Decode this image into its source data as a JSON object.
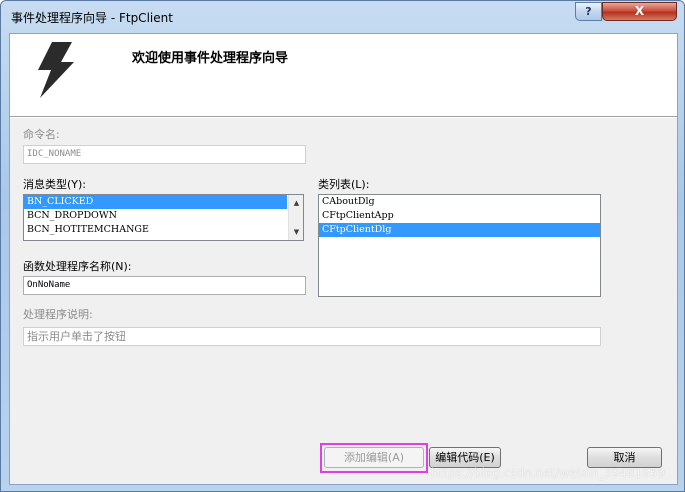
{
  "window": {
    "title": "事件处理程序向导 - FtpClient",
    "help_label": "?",
    "close_label": "X"
  },
  "banner": {
    "icon": "lightning-bolt-icon",
    "title": "欢迎使用事件处理程序向导"
  },
  "command_name": {
    "label": "命令名:",
    "value": "IDC_NONAME"
  },
  "message_type": {
    "label": "消息类型(Y):",
    "items": [
      "BN_CLICKED",
      "BCN_DROPDOWN",
      "BCN_HOTITEMCHANGE"
    ],
    "selected": "BN_CLICKED"
  },
  "class_list": {
    "label": "类列表(L):",
    "items": [
      "CAboutDlg",
      "CFtpClientApp",
      "CFtpClientDlg"
    ],
    "selected": "CFtpClientDlg"
  },
  "handler_name": {
    "label": "函数处理程序名称(N):",
    "value": "OnNoName"
  },
  "handler_desc": {
    "label": "处理程序说明:",
    "value": "指示用户单击了按钮"
  },
  "buttons": {
    "add_edit": "添加编辑(A)",
    "edit_code": "编辑代码(E)",
    "cancel": "取消"
  },
  "watermark": "https://blog.csdn.net/weixin_39481659",
  "colors": {
    "selection": "#3399ff",
    "highlight_box": "#e040e0"
  }
}
